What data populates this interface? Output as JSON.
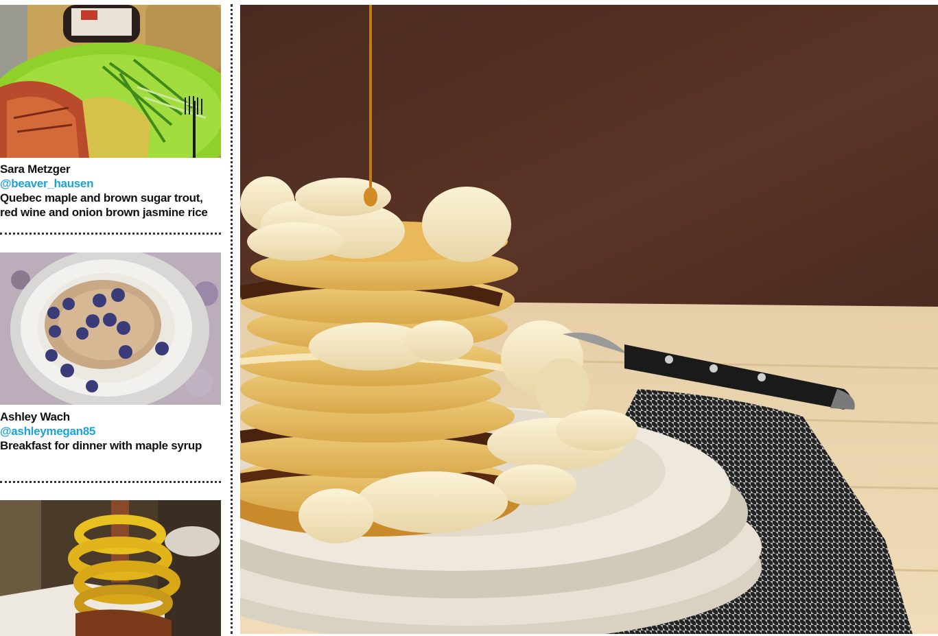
{
  "feed": {
    "posts": [
      {
        "name": "Sara Metzger",
        "handle": "@beaver_hausen",
        "caption": "Quebec maple and brown sugar trout, red wine and onion brown jasmine rice"
      },
      {
        "name": "Ashley Wach",
        "handle": "@ashleymegan85",
        "caption": "Breakfast for dinner with maple syrup"
      }
    ]
  },
  "colors": {
    "handle": "#1aa3d9",
    "text": "#111111",
    "divider": "#333333"
  }
}
